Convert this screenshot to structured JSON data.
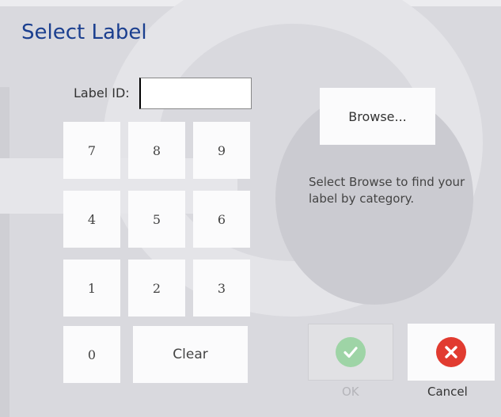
{
  "title": "Select Label",
  "label_id": {
    "label": "Label ID:",
    "value": ""
  },
  "keypad": {
    "keys": [
      "7",
      "8",
      "9",
      "4",
      "5",
      "6",
      "1",
      "2",
      "3",
      "0"
    ],
    "clear_label": "Clear"
  },
  "browse": {
    "label": "Browse...",
    "hint": "Select Browse to find your label by category."
  },
  "actions": {
    "ok_label": "OK",
    "cancel_label": "Cancel"
  },
  "colors": {
    "title": "#1b3f8f",
    "ok_icon_disabled": "#9ed4a6",
    "cancel_icon": "#e13b30"
  },
  "icons": {
    "ok": "checkmark-icon",
    "cancel": "x-icon"
  }
}
